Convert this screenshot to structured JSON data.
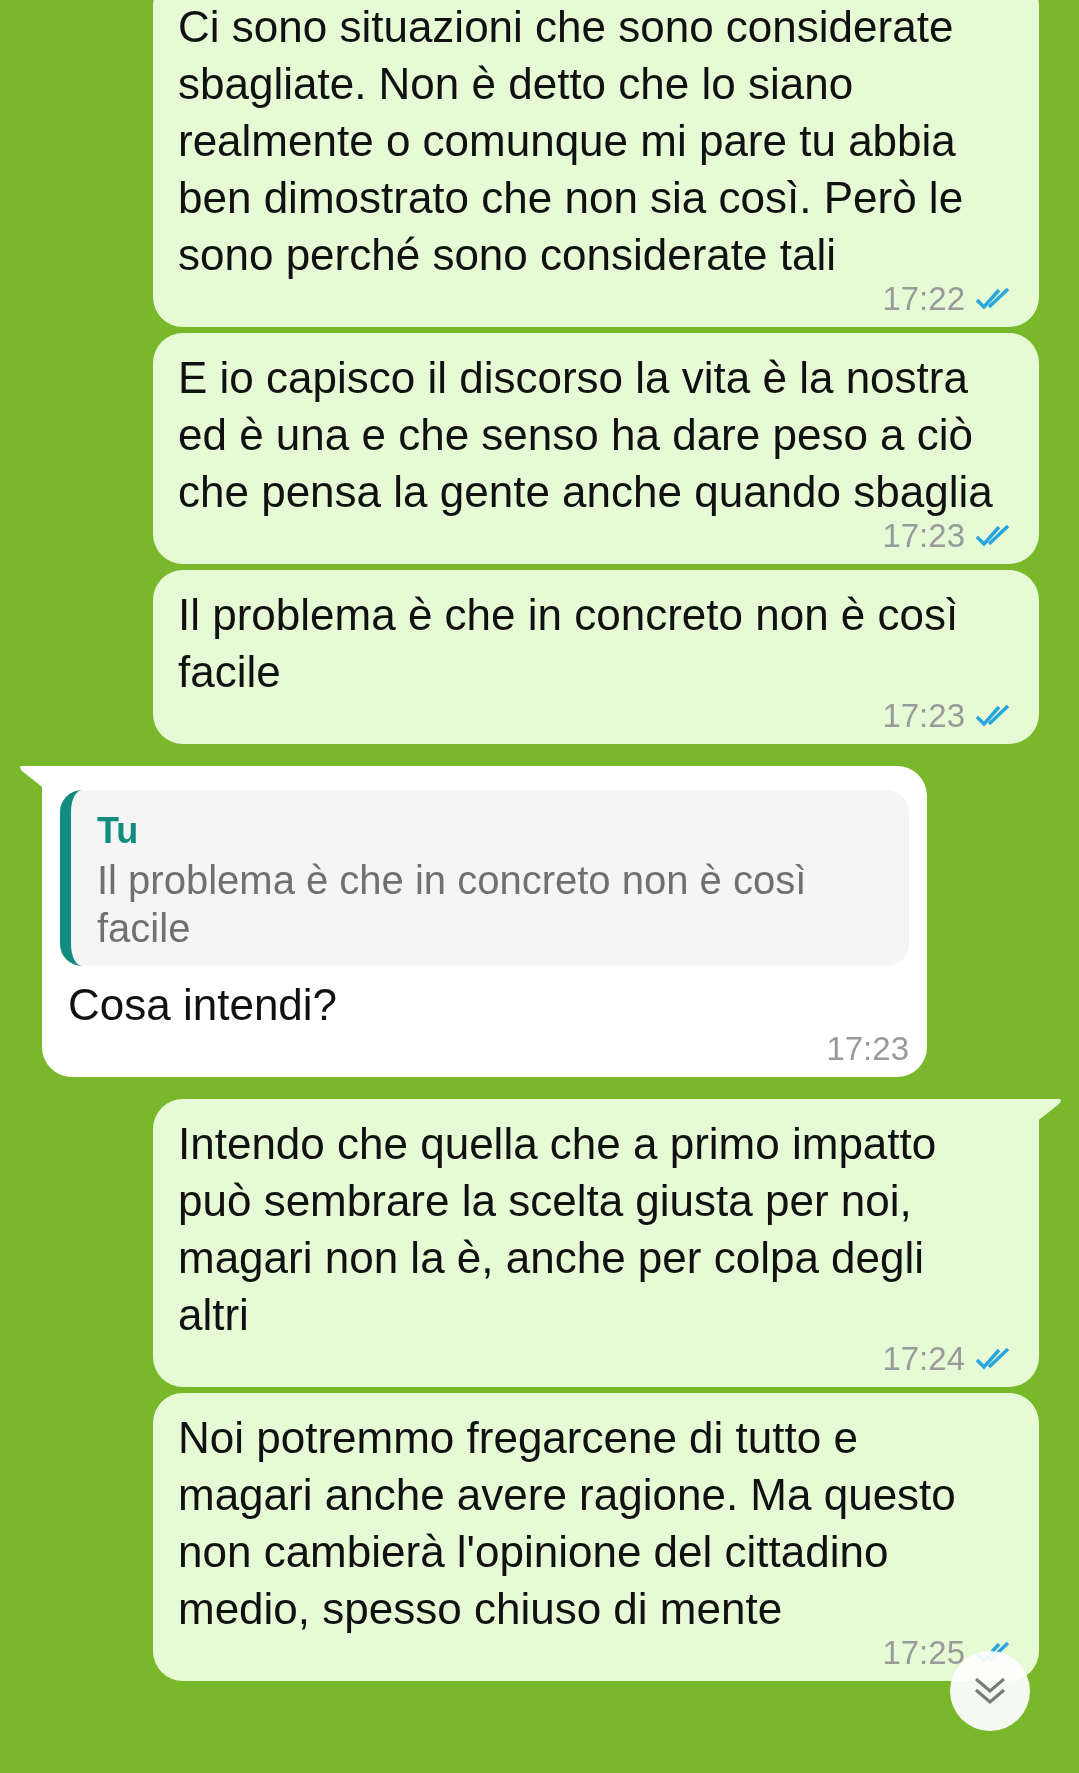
{
  "messages": [
    {
      "kind": "outgoing",
      "tail": false,
      "text": "Ci sono situazioni che sono considerate sbagliate. Non è detto che lo siano realmente o comunque mi pare tu abbia ben dimostrato che non sia così. Però le sono perché sono considerate tali",
      "time": "17:22",
      "read": true
    },
    {
      "kind": "outgoing",
      "tail": false,
      "text": "E io capisco il discorso la vita è la nostra ed è una e che senso ha dare peso a ciò che pensa la gente anche quando sbaglia",
      "time": "17:23",
      "read": true
    },
    {
      "kind": "outgoing",
      "tail": false,
      "text": "Il problema è che in concreto non è così facile",
      "time": "17:23",
      "read": true
    },
    {
      "kind": "incoming",
      "tail": true,
      "quote": {
        "author": "Tu",
        "text": "Il problema è che in concreto non è così facile"
      },
      "text": "Cosa intendi?",
      "time": "17:23"
    },
    {
      "kind": "outgoing",
      "tail": true,
      "text": "Intendo che quella che a primo impatto può sembrare la scelta giusta per noi, magari non la è, anche per colpa degli altri",
      "time": "17:24",
      "read": true
    },
    {
      "kind": "outgoing",
      "tail": false,
      "text": "Noi potremmo fregarcene di tutto e magari anche avere ragione. Ma questo non cambierà l'opinione del cittadino medio, spesso chiuso di mente",
      "time": "17:25",
      "read": true
    }
  ]
}
